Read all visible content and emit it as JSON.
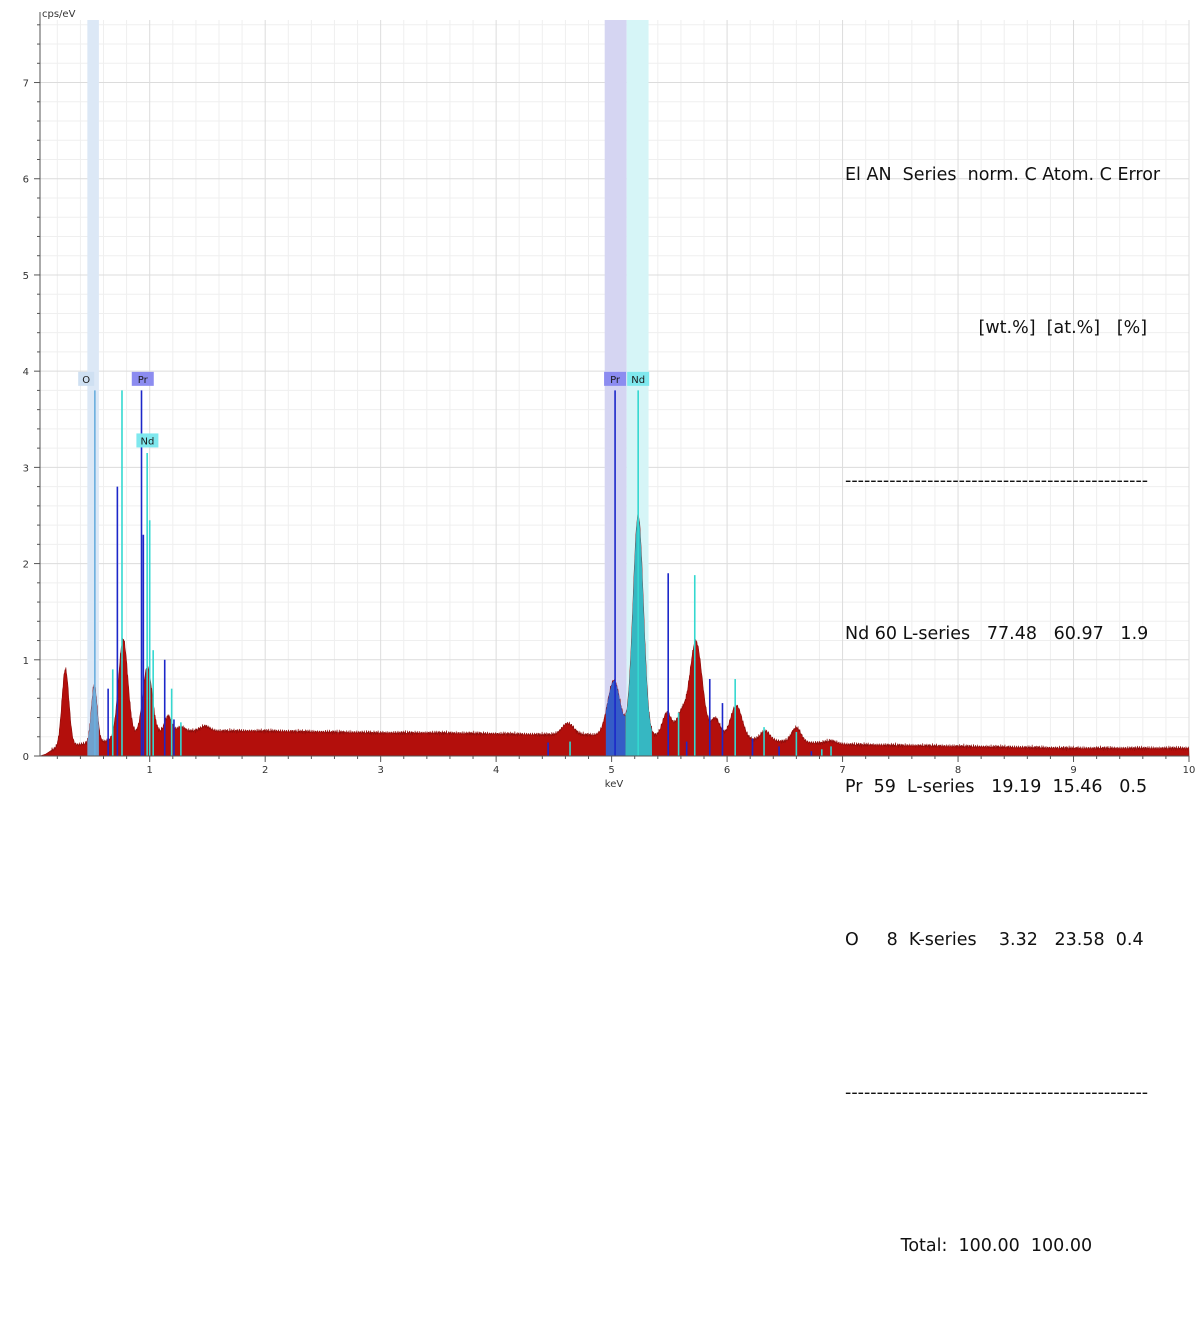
{
  "chart_data": {
    "type": "area",
    "xlabel": "keV",
    "ylabel": "cps/eV",
    "xlim": [
      0.05,
      10
    ],
    "ylim": [
      0,
      7.65
    ],
    "x_ticks": [
      1,
      2,
      3,
      4,
      5,
      6,
      7,
      8,
      9,
      10
    ],
    "y_ticks": [
      0,
      1,
      2,
      3,
      4,
      5,
      6,
      7
    ],
    "grid": true,
    "colors": {
      "spectrum": "#b30f0c",
      "o_fill": "#6aaede",
      "pr_fill": "#2a63d8",
      "nd_fill": "#2bc5d2",
      "pr_line": "#1c27c9",
      "nd_line": "#34d8d0",
      "o_band": "#dce8f6",
      "pr_band": "#d5d5f2",
      "nd_band": "#d6f5f7",
      "o_tag": "#cfe0f2",
      "pr_tag": "#8c8cf0",
      "nd_tag": "#7fe8ee"
    },
    "spectrum": {
      "background": [
        [
          0.05,
          0
        ],
        [
          0.1,
          0.02
        ],
        [
          0.15,
          0.06
        ],
        [
          0.25,
          0.1
        ],
        [
          0.4,
          0.12
        ],
        [
          0.6,
          0.15
        ],
        [
          0.8,
          0.2
        ],
        [
          1.0,
          0.23
        ],
        [
          1.3,
          0.26
        ],
        [
          1.6,
          0.26
        ],
        [
          2.0,
          0.26
        ],
        [
          2.5,
          0.25
        ],
        [
          3.0,
          0.24
        ],
        [
          3.5,
          0.24
        ],
        [
          4.0,
          0.23
        ],
        [
          4.5,
          0.22
        ],
        [
          4.8,
          0.22
        ],
        [
          5.0,
          0.2
        ],
        [
          5.5,
          0.2
        ],
        [
          6.0,
          0.18
        ],
        [
          6.5,
          0.15
        ],
        [
          7.0,
          0.12
        ],
        [
          7.5,
          0.11
        ],
        [
          8.0,
          0.1
        ],
        [
          8.5,
          0.09
        ],
        [
          9.0,
          0.08
        ],
        [
          9.5,
          0.08
        ],
        [
          10.0,
          0.08
        ]
      ],
      "peaks": [
        {
          "center": 0.27,
          "height": 0.8,
          "width": 0.03
        },
        {
          "center": 0.52,
          "height": 0.6,
          "width": 0.025
        },
        {
          "center": 0.77,
          "height": 1.02,
          "width": 0.04
        },
        {
          "center": 0.98,
          "height": 0.7,
          "width": 0.04
        },
        {
          "center": 1.16,
          "height": 0.17,
          "width": 0.03
        },
        {
          "center": 1.27,
          "height": 0.05,
          "width": 0.03
        },
        {
          "center": 1.48,
          "height": 0.05,
          "width": 0.04
        },
        {
          "center": 4.62,
          "height": 0.12,
          "width": 0.05
        },
        {
          "center": 5.02,
          "height": 0.58,
          "width": 0.055
        },
        {
          "center": 5.23,
          "height": 2.3,
          "width": 0.045
        },
        {
          "center": 5.48,
          "height": 0.25,
          "width": 0.04
        },
        {
          "center": 5.6,
          "height": 0.22,
          "width": 0.04
        },
        {
          "center": 5.73,
          "height": 1.0,
          "width": 0.055
        },
        {
          "center": 5.9,
          "height": 0.2,
          "width": 0.04
        },
        {
          "center": 6.08,
          "height": 0.35,
          "width": 0.05
        },
        {
          "center": 6.33,
          "height": 0.1,
          "width": 0.04
        },
        {
          "center": 6.6,
          "height": 0.15,
          "width": 0.04
        },
        {
          "center": 6.9,
          "height": 0.03,
          "width": 0.05
        }
      ],
      "fills": [
        {
          "element": "O",
          "from": 0.46,
          "to": 0.56
        },
        {
          "element": "Pr",
          "from": 4.95,
          "to": 5.12
        },
        {
          "element": "Nd",
          "from": 5.12,
          "to": 5.35
        }
      ]
    },
    "marker_lines": [
      {
        "element": "O",
        "x": 0.525,
        "y": 3.8
      },
      {
        "element": "Nd",
        "x": 0.68,
        "y": 0.9
      },
      {
        "element": "Pr",
        "x": 0.64,
        "y": 0.7
      },
      {
        "element": "Pr",
        "x": 0.72,
        "y": 2.8
      },
      {
        "element": "Nd",
        "x": 0.76,
        "y": 3.8
      },
      {
        "element": "Pr",
        "x": 0.929,
        "y": 3.8
      },
      {
        "element": "Pr",
        "x": 0.945,
        "y": 2.3
      },
      {
        "element": "Nd",
        "x": 0.978,
        "y": 3.15
      },
      {
        "element": "Nd",
        "x": 1.0,
        "y": 2.45
      },
      {
        "element": "Nd",
        "x": 1.03,
        "y": 1.1
      },
      {
        "element": "Pr",
        "x": 1.13,
        "y": 1.0
      },
      {
        "element": "Nd",
        "x": 1.19,
        "y": 0.7
      },
      {
        "element": "Pr",
        "x": 1.21,
        "y": 0.38
      },
      {
        "element": "Nd",
        "x": 1.27,
        "y": 0.35
      },
      {
        "element": "Pr",
        "x": 4.45,
        "y": 0.14
      },
      {
        "element": "Nd",
        "x": 4.64,
        "y": 0.15
      },
      {
        "element": "Pr",
        "x": 5.03,
        "y": 3.8
      },
      {
        "element": "Nd",
        "x": 5.23,
        "y": 3.8
      },
      {
        "element": "Pr",
        "x": 5.49,
        "y": 1.9
      },
      {
        "element": "Nd",
        "x": 5.58,
        "y": 0.45
      },
      {
        "element": "Pr",
        "x": 5.65,
        "y": 0.15
      },
      {
        "element": "Nd",
        "x": 5.72,
        "y": 1.88
      },
      {
        "element": "Pr",
        "x": 5.85,
        "y": 0.8
      },
      {
        "element": "Pr",
        "x": 5.96,
        "y": 0.55
      },
      {
        "element": "Nd",
        "x": 6.07,
        "y": 0.8
      },
      {
        "element": "Pr",
        "x": 6.22,
        "y": 0.18
      },
      {
        "element": "Nd",
        "x": 6.32,
        "y": 0.3
      },
      {
        "element": "Pr",
        "x": 6.45,
        "y": 0.1
      },
      {
        "element": "Nd",
        "x": 6.6,
        "y": 0.25
      },
      {
        "element": "Pr",
        "x": 6.73,
        "y": 0.05
      },
      {
        "element": "Nd",
        "x": 6.82,
        "y": 0.07
      },
      {
        "element": "Nd",
        "x": 6.9,
        "y": 0.1
      }
    ],
    "bands": [
      {
        "element": "O",
        "from": 0.46,
        "to": 0.56
      },
      {
        "element": "Pr",
        "from": 4.94,
        "to": 5.13
      },
      {
        "element": "Nd",
        "from": 5.13,
        "to": 5.32
      }
    ],
    "element_tags": [
      {
        "label": "O",
        "x": 0.45,
        "y": 3.92,
        "element": "O"
      },
      {
        "label": "Pr",
        "x": 0.94,
        "y": 3.92,
        "element": "Pr"
      },
      {
        "label": "Nd",
        "x": 0.98,
        "y": 3.28,
        "element": "Nd"
      },
      {
        "label": "Pr",
        "x": 5.03,
        "y": 3.92,
        "element": "Pr"
      },
      {
        "label": "Nd",
        "x": 5.23,
        "y": 3.92,
        "element": "Nd"
      }
    ]
  },
  "results": {
    "header": "El AN  Series  norm. C Atom. C Error",
    "units": "                        [wt.%]  [at.%]   [%]",
    "separator": "------------------------------------------------",
    "rows": [
      "Nd 60 L-series   77.48   60.97   1.9",
      "Pr  59  L-series   19.19  15.46   0.5",
      "O     8  K-series    3.32   23.58  0.4"
    ],
    "total": "          Total:  100.00  100.00"
  }
}
